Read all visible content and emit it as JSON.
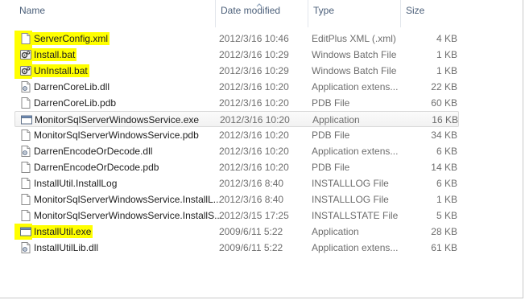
{
  "columns": {
    "name": "Name",
    "date": "Date modified",
    "type": "Type",
    "size": "Size"
  },
  "files": [
    {
      "name": "ServerConfig.xml",
      "date": "2012/3/16 10:46",
      "type": "EditPlus XML (.xml)",
      "size": "4 KB",
      "icon": "document-icon",
      "highlighted": true
    },
    {
      "name": "Install.bat",
      "date": "2012/3/16 10:29",
      "type": "Windows Batch File",
      "size": "1 KB",
      "icon": "gear-script-icon",
      "highlighted": true
    },
    {
      "name": "UnInstall.bat",
      "date": "2012/3/16 10:29",
      "type": "Windows Batch File",
      "size": "1 KB",
      "icon": "gear-script-icon",
      "highlighted": true
    },
    {
      "name": "DarrenCoreLib.dll",
      "date": "2012/3/16 10:20",
      "type": "Application extens...",
      "size": "22 KB",
      "icon": "dll-icon",
      "highlighted": false
    },
    {
      "name": "DarrenCoreLib.pdb",
      "date": "2012/3/16 10:20",
      "type": "PDB File",
      "size": "60 KB",
      "icon": "document-icon",
      "highlighted": false
    },
    {
      "name": "MonitorSqlServerWindowsService.exe",
      "date": "2012/3/16 10:20",
      "type": "Application",
      "size": "16 KB",
      "icon": "application-icon",
      "highlighted": false,
      "selected": true
    },
    {
      "name": "MonitorSqlServerWindowsService.pdb",
      "date": "2012/3/16 10:20",
      "type": "PDB File",
      "size": "34 KB",
      "icon": "document-icon",
      "highlighted": false
    },
    {
      "name": "DarrenEncodeOrDecode.dll",
      "date": "2012/3/16 10:20",
      "type": "Application extens...",
      "size": "6 KB",
      "icon": "dll-icon",
      "highlighted": false
    },
    {
      "name": "DarrenEncodeOrDecode.pdb",
      "date": "2012/3/16 10:20",
      "type": "PDB File",
      "size": "14 KB",
      "icon": "document-icon",
      "highlighted": false
    },
    {
      "name": "InstallUtil.InstallLog",
      "date": "2012/3/16 8:40",
      "type": "INSTALLLOG File",
      "size": "6 KB",
      "icon": "document-icon",
      "highlighted": false
    },
    {
      "name": "MonitorSqlServerWindowsService.InstallL...",
      "date": "2012/3/16 8:40",
      "type": "INSTALLLOG File",
      "size": "1 KB",
      "icon": "document-icon",
      "highlighted": false
    },
    {
      "name": "MonitorSqlServerWindowsService.InstallS...",
      "date": "2012/3/15 17:25",
      "type": "INSTALLSTATE File",
      "size": "5 KB",
      "icon": "document-icon",
      "highlighted": false
    },
    {
      "name": "InstallUtil.exe",
      "date": "2009/6/11 5:22",
      "type": "Application",
      "size": "28 KB",
      "icon": "application-icon",
      "highlighted": true
    },
    {
      "name": "InstallUtilLib.dll",
      "date": "2009/6/11 5:22",
      "type": "Application extens...",
      "size": "61 KB",
      "icon": "dll-icon",
      "highlighted": false
    }
  ],
  "colors": {
    "highlight": "#ffff00",
    "header_text": "#4c607a"
  }
}
